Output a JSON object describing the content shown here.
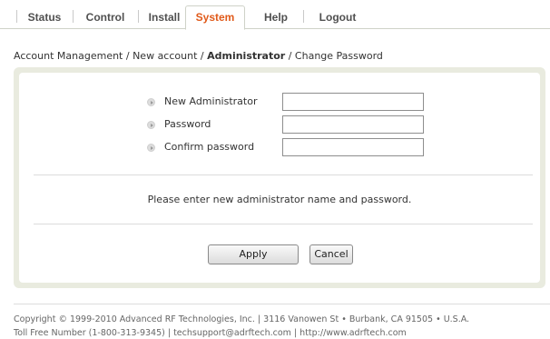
{
  "nav": {
    "items": [
      {
        "label": "Status",
        "active": false
      },
      {
        "label": "Control",
        "active": false
      },
      {
        "label": "Install",
        "active": false
      },
      {
        "label": "System",
        "active": true
      },
      {
        "label": "Help",
        "active": false
      },
      {
        "label": "Logout",
        "active": false
      }
    ]
  },
  "breadcrumb": {
    "part1": "Account Management",
    "sep": " / ",
    "part2": "New account",
    "current": "Administrator",
    "part4": "Change Password"
  },
  "form": {
    "fields": [
      {
        "label": "New Administrator",
        "value": ""
      },
      {
        "label": "Password",
        "value": ""
      },
      {
        "label": "Confirm password",
        "value": ""
      }
    ],
    "message": "Please enter new administrator name and password.",
    "apply_label": "Apply",
    "cancel_label": "Cancel"
  },
  "footer": {
    "line1": "Copyright © 1999-2010 Advanced RF Technologies, Inc. | 3116 Vanowen St • Burbank, CA 91505 • U.S.A.",
    "line2": "Toll Free Number (1-800-313-9345) | techsupport@adrftech.com | http://www.adrftech.com"
  },
  "colors": {
    "active_tab": "#e05a1a",
    "panel_border": "#e9ebdf"
  }
}
